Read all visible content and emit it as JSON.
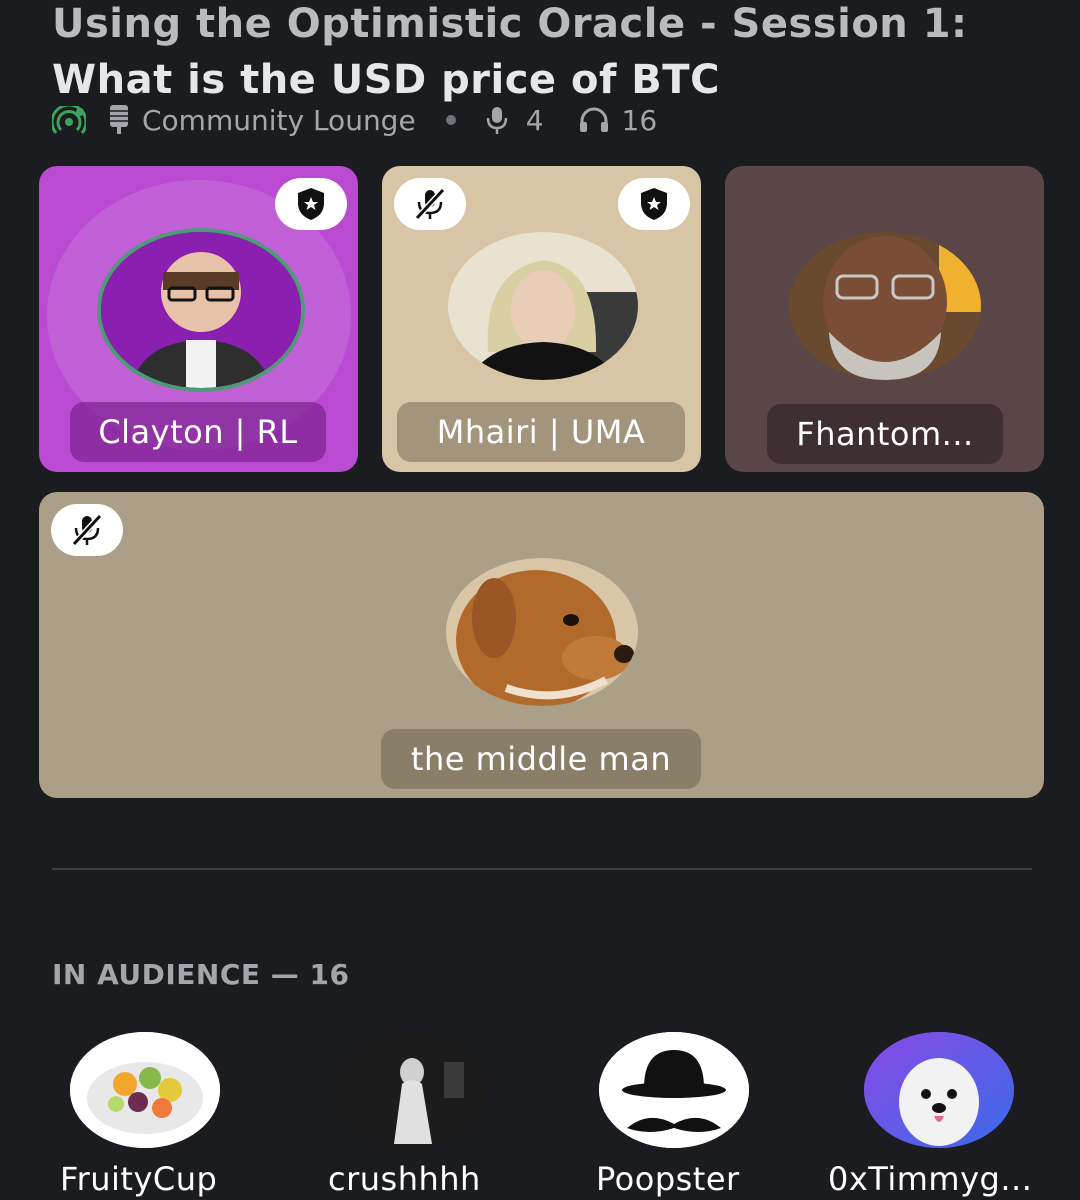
{
  "stage": {
    "title_line1": "Using the Optimistic Oracle - Session 1:",
    "title_line2": "What is the USD price of BTC",
    "channel": "Community Lounge",
    "speaker_count": "4",
    "listener_count": "16"
  },
  "speakers": [
    {
      "name": "Clayton | RL",
      "muted": false,
      "moderator": true,
      "speaking": true,
      "bg": "#b94ad1"
    },
    {
      "name": "Mhairi | UMA",
      "muted": true,
      "moderator": true,
      "speaking": false,
      "bg": "#d8c5a6"
    },
    {
      "name": "Fhantom...",
      "muted": false,
      "moderator": false,
      "speaking": false,
      "bg": "#5a4547"
    },
    {
      "name": "the middle man",
      "muted": true,
      "moderator": false,
      "speaking": false,
      "bg": "#ab9f87"
    }
  ],
  "audience": {
    "header": "IN AUDIENCE — 16",
    "members": [
      {
        "name": "FruityCup"
      },
      {
        "name": "crushhhh"
      },
      {
        "name": "Poopster"
      },
      {
        "name": "0xTimmyg..."
      }
    ]
  },
  "icons": {
    "stage": "stage-live-icon",
    "channel": "channel-icon",
    "speakers": "microphone-icon",
    "listeners": "headphones-icon",
    "moderator": "moderator-shield-icon",
    "muted": "muted-microphone-icon"
  },
  "colors": {
    "background": "#1b1c20",
    "live_green": "#3ba55c",
    "speaking_ring": "#4e9a78"
  }
}
